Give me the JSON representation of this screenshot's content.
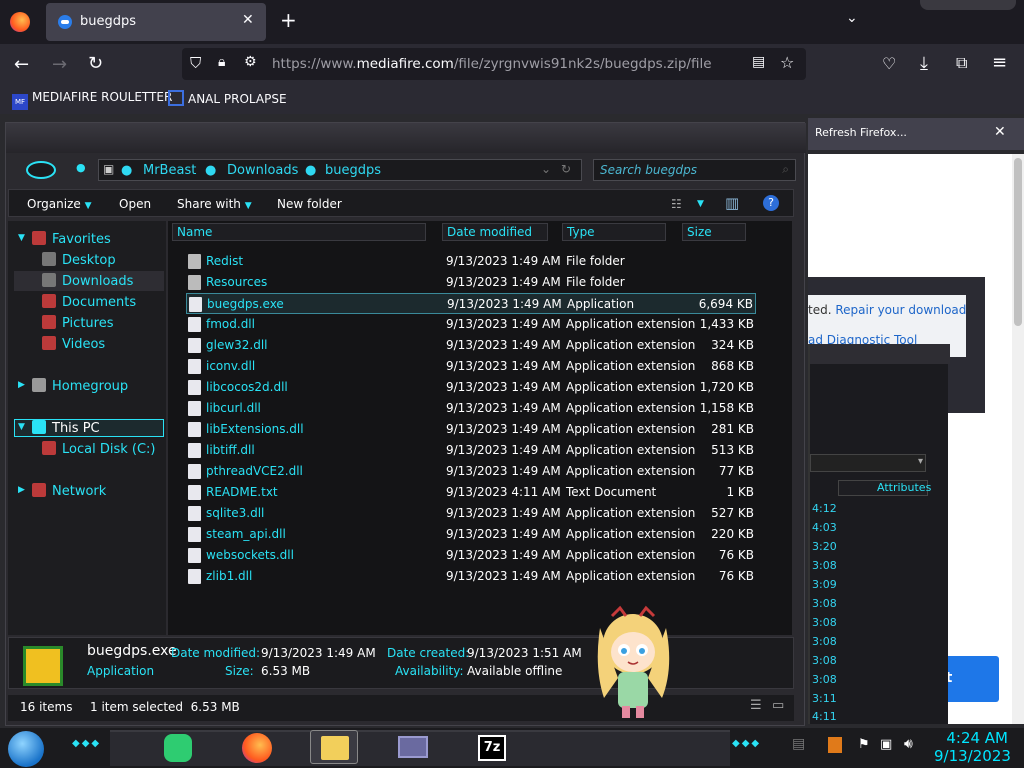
{
  "browser": {
    "tab_title": "buegdps",
    "url_prefix": "https://www.",
    "url_domain": "mediafire.com",
    "url_path": "/file/zyrgnvwis91nk2s/buegdps.zip/file",
    "bookmarks": [
      "MEDIAFIRE ROULETTER",
      "ANAL PROLAPSE"
    ],
    "bookmark_icon_text": "MF"
  },
  "page_behind": {
    "notification": "Refresh Firefox...",
    "repair_prefix": "ted. ",
    "repair_link": "Repair your download",
    "diag_link": "ad Diagnostic Tool",
    "button_text": "ot",
    "attributes_header": "Attributes",
    "times": [
      "4:12",
      "4:03",
      "3:20",
      "3:08",
      "3:09",
      "3:08",
      "3:08",
      "3:08",
      "3:08",
      "3:08",
      "3:11",
      "4:11"
    ]
  },
  "explorer": {
    "breadcrumb": [
      "MrBeast",
      "Downloads",
      "buegdps"
    ],
    "search_placeholder": "Search buegdps",
    "toolbar": {
      "organize": "Organize",
      "open": "Open",
      "share": "Share with",
      "new_folder": "New folder"
    },
    "nav": {
      "favorites": "Favorites",
      "desktop": "Desktop",
      "downloads": "Downloads",
      "documents": "Documents",
      "pictures": "Pictures",
      "videos": "Videos",
      "homegroup": "Homegroup",
      "this_pc": "This PC",
      "local_disk": "Local Disk (C:)",
      "network": "Network"
    },
    "columns": {
      "name": "Name",
      "date": "Date modified",
      "type": "Type",
      "size": "Size"
    },
    "files": [
      {
        "name": "Redist",
        "date": "9/13/2023 1:49 AM",
        "type": "File folder",
        "size": ""
      },
      {
        "name": "Resources",
        "date": "9/13/2023 1:49 AM",
        "type": "File folder",
        "size": ""
      },
      {
        "name": "buegdps.exe",
        "date": "9/13/2023 1:49 AM",
        "type": "Application",
        "size": "6,694 KB"
      },
      {
        "name": "fmod.dll",
        "date": "9/13/2023 1:49 AM",
        "type": "Application extension",
        "size": "1,433 KB"
      },
      {
        "name": "glew32.dll",
        "date": "9/13/2023 1:49 AM",
        "type": "Application extension",
        "size": "324 KB"
      },
      {
        "name": "iconv.dll",
        "date": "9/13/2023 1:49 AM",
        "type": "Application extension",
        "size": "868 KB"
      },
      {
        "name": "libcocos2d.dll",
        "date": "9/13/2023 1:49 AM",
        "type": "Application extension",
        "size": "1,720 KB"
      },
      {
        "name": "libcurl.dll",
        "date": "9/13/2023 1:49 AM",
        "type": "Application extension",
        "size": "1,158 KB"
      },
      {
        "name": "libExtensions.dll",
        "date": "9/13/2023 1:49 AM",
        "type": "Application extension",
        "size": "281 KB"
      },
      {
        "name": "libtiff.dll",
        "date": "9/13/2023 1:49 AM",
        "type": "Application extension",
        "size": "513 KB"
      },
      {
        "name": "pthreadVCE2.dll",
        "date": "9/13/2023 1:49 AM",
        "type": "Application extension",
        "size": "77 KB"
      },
      {
        "name": "README.txt",
        "date": "9/13/2023 4:11 AM",
        "type": "Text Document",
        "size": "1 KB"
      },
      {
        "name": "sqlite3.dll",
        "date": "9/13/2023 1:49 AM",
        "type": "Application extension",
        "size": "527 KB"
      },
      {
        "name": "steam_api.dll",
        "date": "9/13/2023 1:49 AM",
        "type": "Application extension",
        "size": "220 KB"
      },
      {
        "name": "websockets.dll",
        "date": "9/13/2023 1:49 AM",
        "type": "Application extension",
        "size": "76 KB"
      },
      {
        "name": "zlib1.dll",
        "date": "9/13/2023 1:49 AM",
        "type": "Application extension",
        "size": "76 KB"
      }
    ],
    "selected_index": 2,
    "details": {
      "filename": "buegdps.exe",
      "filetype": "Application",
      "date_modified_label": "Date modified:",
      "date_modified": "9/13/2023 1:49 AM",
      "size_label": "Size:",
      "size": "6.53 MB",
      "date_created_label": "Date created:",
      "date_created": "9/13/2023 1:51 AM",
      "availability_label": "Availability:",
      "availability": "Available offline"
    },
    "status": {
      "count": "16 items",
      "selection": "1 item selected  6.53 MB"
    }
  },
  "taskbar": {
    "time": "4:24 AM",
    "date": "9/13/2023",
    "app_7z": "7z"
  },
  "colors": {
    "accent": "#2ae2f5",
    "panel": "#1b1b1e"
  }
}
